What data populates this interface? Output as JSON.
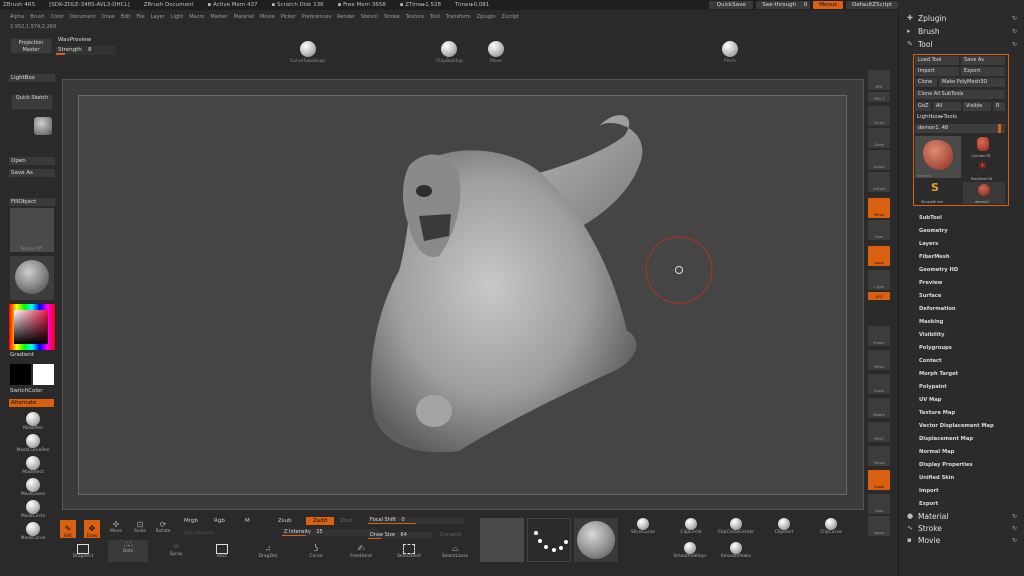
{
  "title_bar": {
    "app": "ZBrush 4R5",
    "doc_info": "[SDK-ZDLE-348S-AVL3-DHCL]",
    "doc_name": "ZBrush Document",
    "active_mem": "▪ Active Mem 437",
    "scratch_disk": "▪ Scratch Disk 136",
    "free_mem": "▪ Free Mem 3658",
    "ztime": "▪ ZTime▸1.528",
    "timer": "Timer▸0.081",
    "quicksave": "QuickSave",
    "see_through": "See-through",
    "see_through_value": "0",
    "menus": "Menus",
    "default_zscript": "DefaultZScript"
  },
  "menu_bar": [
    "Alpha",
    "Brush",
    "Color",
    "Document",
    "Draw",
    "Edit",
    "File",
    "Layer",
    "Light",
    "Macro",
    "Marker",
    "Material",
    "Movie",
    "Picker",
    "Preferences",
    "Render",
    "Stencil",
    "Stroke",
    "Texture",
    "Tool",
    "Transform",
    "Zplugin",
    "Zscript"
  ],
  "coords": "2.952,1.974,2.269",
  "top_shelf": {
    "projection_master": "Projection Master",
    "brush_name": "WaxPreview",
    "strength_label": "Strength",
    "strength_value": "8",
    "strength_fraction": 0.15,
    "brushes": [
      {
        "label": "CurveTubeSnap"
      },
      {
        "label": "ClayBuildup"
      },
      {
        "label": "Move"
      },
      {
        "label": "Pinch"
      }
    ]
  },
  "left_tray": {
    "lightbox": "LightBox",
    "quick_sketch": "Quick Sketch",
    "open": "Open",
    "save_as": "Save As",
    "fill_object": "FillObject",
    "alpha_off": "Texture Off",
    "gradient": "Gradient",
    "switch_color": "SwitchColor",
    "alternate": "Alternate",
    "brushes": [
      "MaskPen",
      "MaskCurvePen",
      "MaskRect",
      "MaskLasso",
      "MaskCircle",
      "MaskCurve"
    ]
  },
  "right_shelf": [
    {
      "label": "BPR"
    },
    {
      "label": "SPix 3"
    },
    {
      "label": "Scroll"
    },
    {
      "label": "Zoom"
    },
    {
      "label": "Actual"
    },
    {
      "label": "AAHalf"
    },
    {
      "label": "Persp"
    },
    {
      "label": "Floor"
    },
    {
      "label": "Local"
    },
    {
      "label": "L.Sym"
    },
    {
      "label": "XYZ"
    },
    {
      "label": "Frame"
    },
    {
      "label": "Move"
    },
    {
      "label": "Scale"
    },
    {
      "label": "Rotate"
    },
    {
      "label": "PolyF"
    },
    {
      "label": "Transp"
    },
    {
      "label": "Ghost"
    },
    {
      "label": "Solo"
    },
    {
      "label": "Xpose"
    }
  ],
  "right_panel": {
    "zplugin": "Zplugin",
    "brush": "Brush",
    "tool": "Tool",
    "load_tool": "Load Tool",
    "save_as": "Save As",
    "import": "Import",
    "export": "Export",
    "clone": "Clone",
    "make_polymesh": "Make PolyMesh3D",
    "clone_all_subtools": "Clone All SubTools",
    "goz": "GoZ",
    "all": "All",
    "visible": "Visible",
    "r": "R",
    "lightbox_tools": "Lightbox▸Tools",
    "current_tool": "demon1. 48",
    "tool_thumbs": [
      {
        "label": "demon1"
      },
      {
        "label": "Cylinder3D"
      },
      {
        "label": "PolyMesh3D"
      },
      {
        "label": "SimpleBrush"
      },
      {
        "label": "demon1"
      }
    ],
    "sub_palettes": [
      "SubTool",
      "Geometry",
      "Layers",
      "FiberMesh",
      "Geometry HD",
      "Preview",
      "Surface",
      "Deformation",
      "Masking",
      "Visibility",
      "Polygroups",
      "Contact",
      "Morph Target",
      "Polypaint",
      "UV Map",
      "Texture Map",
      "Vector Displacement Map",
      "Displacement Map",
      "Normal Map",
      "Display Properties",
      "Unified Skin",
      "Import",
      "Export"
    ],
    "material": "Material",
    "stroke": "Stroke",
    "movie": "Movie"
  },
  "bottom_shelf": {
    "edit": "Edit",
    "draw": "Draw",
    "move": "Move",
    "scale": "Scale",
    "rotate": "Rotate",
    "mrgb": "Mrgb",
    "rgb": "Rgb",
    "m": "M",
    "zsub": "Zsub",
    "zadd": "Zadd",
    "zcut": "Zcut",
    "focal_shift_label": "Focal Shift",
    "focal_shift_value": "0",
    "focal_shift_fraction": 0.5,
    "z_intensity_label": "Z Intensity",
    "z_intensity_value": "25",
    "z_intensity_fraction": 0.25,
    "draw_size_label": "Draw Size",
    "draw_size_value": "64",
    "draw_size_fraction": 0.2,
    "dynamic": "Dynamic",
    "rgb_intensity": "Rgb Intensity",
    "strokes": [
      "DragRect",
      "Dots",
      "Spray",
      "Rect",
      "DragDot",
      "Curve",
      "FreeHand",
      "SelectRect",
      "SelectLasso"
    ],
    "mini_brushes": [
      "SliceCurve",
      "ClipCircle",
      "ClipCircleCenter",
      "ClipRect",
      "ClipCurve",
      "SmoothValleys",
      "SmoothPeaks"
    ]
  },
  "colors": {
    "accent": "#d9600f",
    "bg": "#2a2a2a",
    "canvas": "#454545",
    "primary_color": "#000000",
    "secondary_color": "#ffffff"
  }
}
